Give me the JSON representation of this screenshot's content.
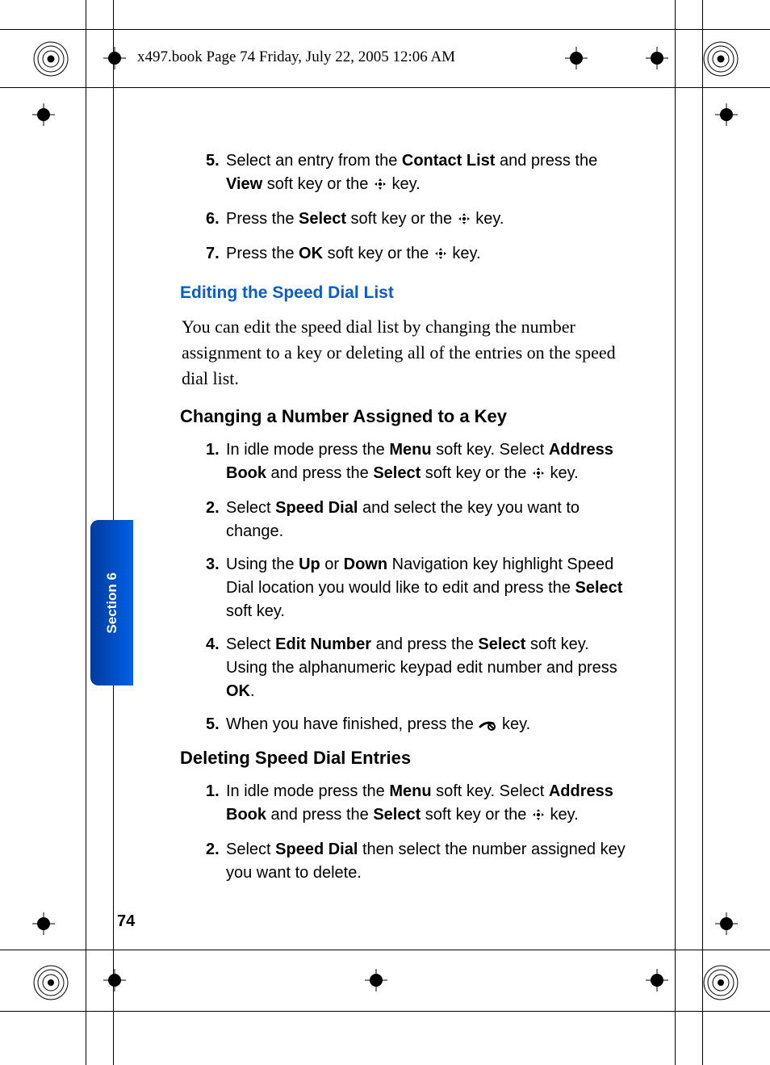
{
  "slug": "x497.book  Page 74  Friday, July 22, 2005  12:06 AM",
  "section_tab": "Section 6",
  "page_number": "74",
  "list_a": [
    {
      "n": "5.",
      "parts": [
        {
          "t": "Select an entry from the "
        },
        {
          "t": "Contact List",
          "b": true
        },
        {
          "t": " and press the "
        },
        {
          "t": "View",
          "b": true
        },
        {
          "t": " soft key or the "
        },
        {
          "icon": "nav"
        },
        {
          "t": " key."
        }
      ]
    },
    {
      "n": "6.",
      "parts": [
        {
          "t": "Press the "
        },
        {
          "t": "Select",
          "b": true
        },
        {
          "t": " soft key or the "
        },
        {
          "icon": "nav"
        },
        {
          "t": " key."
        }
      ]
    },
    {
      "n": "7.",
      "parts": [
        {
          "t": "Press the "
        },
        {
          "t": "OK",
          "b": true
        },
        {
          "t": " soft key or the "
        },
        {
          "icon": "nav"
        },
        {
          "t": " key."
        }
      ]
    }
  ],
  "h_blue": "Editing the Speed Dial List",
  "para": "You can edit the speed dial list by changing the number assignment to a key or deleting all of the entries on the speed dial list.",
  "h_bold_1": "Changing a Number Assigned to a Key",
  "list_b": [
    {
      "n": "1.",
      "parts": [
        {
          "t": "In idle mode press the "
        },
        {
          "t": "Menu",
          "b": true
        },
        {
          "t": " soft key. Select "
        },
        {
          "t": "Address Book",
          "b": true
        },
        {
          "t": " and press the "
        },
        {
          "t": "Select",
          "b": true
        },
        {
          "t": " soft key or the "
        },
        {
          "icon": "nav"
        },
        {
          "t": " key."
        }
      ]
    },
    {
      "n": "2.",
      "parts": [
        {
          "t": "Select "
        },
        {
          "t": "Speed Dial",
          "b": true
        },
        {
          "t": " and select the key you want to change."
        }
      ]
    },
    {
      "n": "3.",
      "parts": [
        {
          "t": "Using the "
        },
        {
          "t": "Up",
          "b": true
        },
        {
          "t": " or "
        },
        {
          "t": "Down",
          "b": true
        },
        {
          "t": " Navigation key highlight Speed Dial location you would like to edit and press the "
        },
        {
          "t": "Select",
          "b": true
        },
        {
          "t": " soft key."
        }
      ]
    },
    {
      "n": "4.",
      "parts": [
        {
          "t": "Select "
        },
        {
          "t": "Edit Number",
          "b": true
        },
        {
          "t": " and press the "
        },
        {
          "t": "Select",
          "b": true
        },
        {
          "t": " soft key. Using the alphanumeric keypad edit number and press "
        },
        {
          "t": "OK",
          "b": true
        },
        {
          "t": "."
        }
      ]
    },
    {
      "n": "5.",
      "parts": [
        {
          "t": "When you have finished, press the "
        },
        {
          "icon": "end"
        },
        {
          "t": " key."
        }
      ]
    }
  ],
  "h_bold_2": "Deleting Speed Dial Entries",
  "list_c": [
    {
      "n": "1.",
      "parts": [
        {
          "t": "In idle mode press the "
        },
        {
          "t": "Menu",
          "b": true
        },
        {
          "t": " soft key. Select "
        },
        {
          "t": "Address Book",
          "b": true
        },
        {
          "t": " and press the "
        },
        {
          "t": "Select",
          "b": true
        },
        {
          "t": " soft key or the "
        },
        {
          "icon": "nav"
        },
        {
          "t": " key."
        }
      ]
    },
    {
      "n": "2.",
      "parts": [
        {
          "t": "Select "
        },
        {
          "t": "Speed Dial",
          "b": true
        },
        {
          "t": " then select the number assigned key you want to delete."
        }
      ]
    }
  ]
}
